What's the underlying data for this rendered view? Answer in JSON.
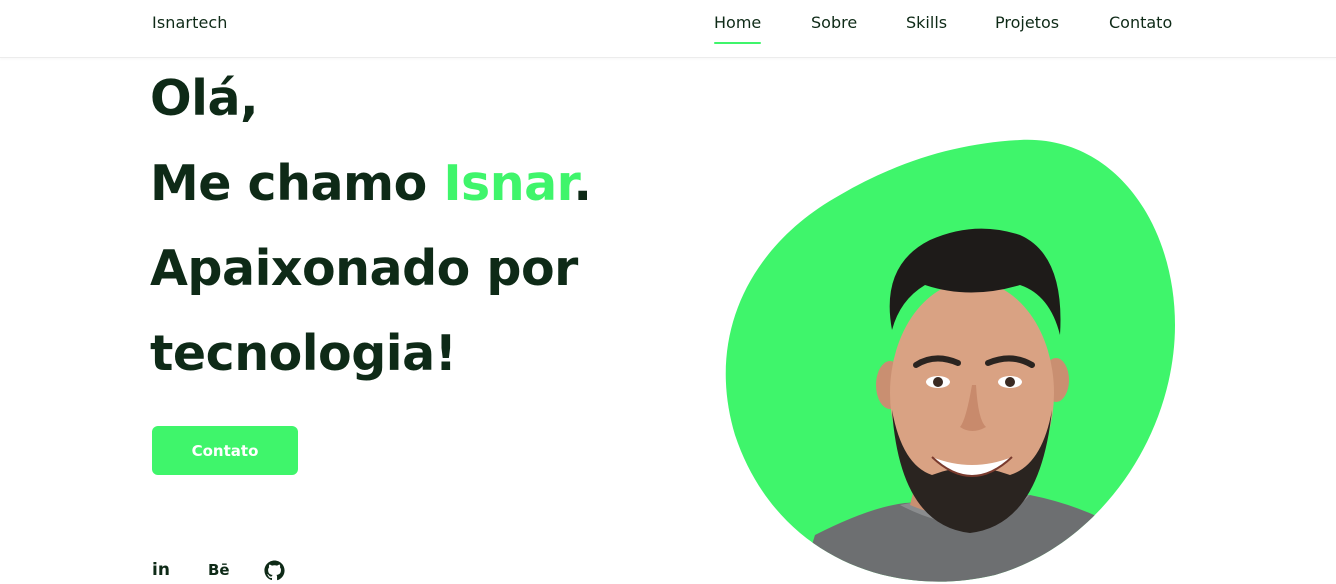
{
  "header": {
    "logo": "Isnartech",
    "nav": [
      {
        "label": "Home",
        "active": true
      },
      {
        "label": "Sobre",
        "active": false
      },
      {
        "label": "Skills",
        "active": false
      },
      {
        "label": "Projetos",
        "active": false
      },
      {
        "label": "Contato",
        "active": false
      }
    ]
  },
  "hero": {
    "line1": "Olá,",
    "line2_prefix": "Me chamo ",
    "line2_name": "Isnar",
    "line2_suffix": ".",
    "line3": "Apaixonado por",
    "line4": "tecnologia!",
    "cta_label": "Contato"
  },
  "socials": [
    {
      "icon": "linkedin-icon",
      "glyph": "in"
    },
    {
      "icon": "behance-icon",
      "glyph": "Bē"
    },
    {
      "icon": "github-icon",
      "glyph": ""
    }
  ],
  "colors": {
    "accent": "#3ff56b",
    "text_dark": "#0e2a17",
    "background": "#ffffff"
  }
}
